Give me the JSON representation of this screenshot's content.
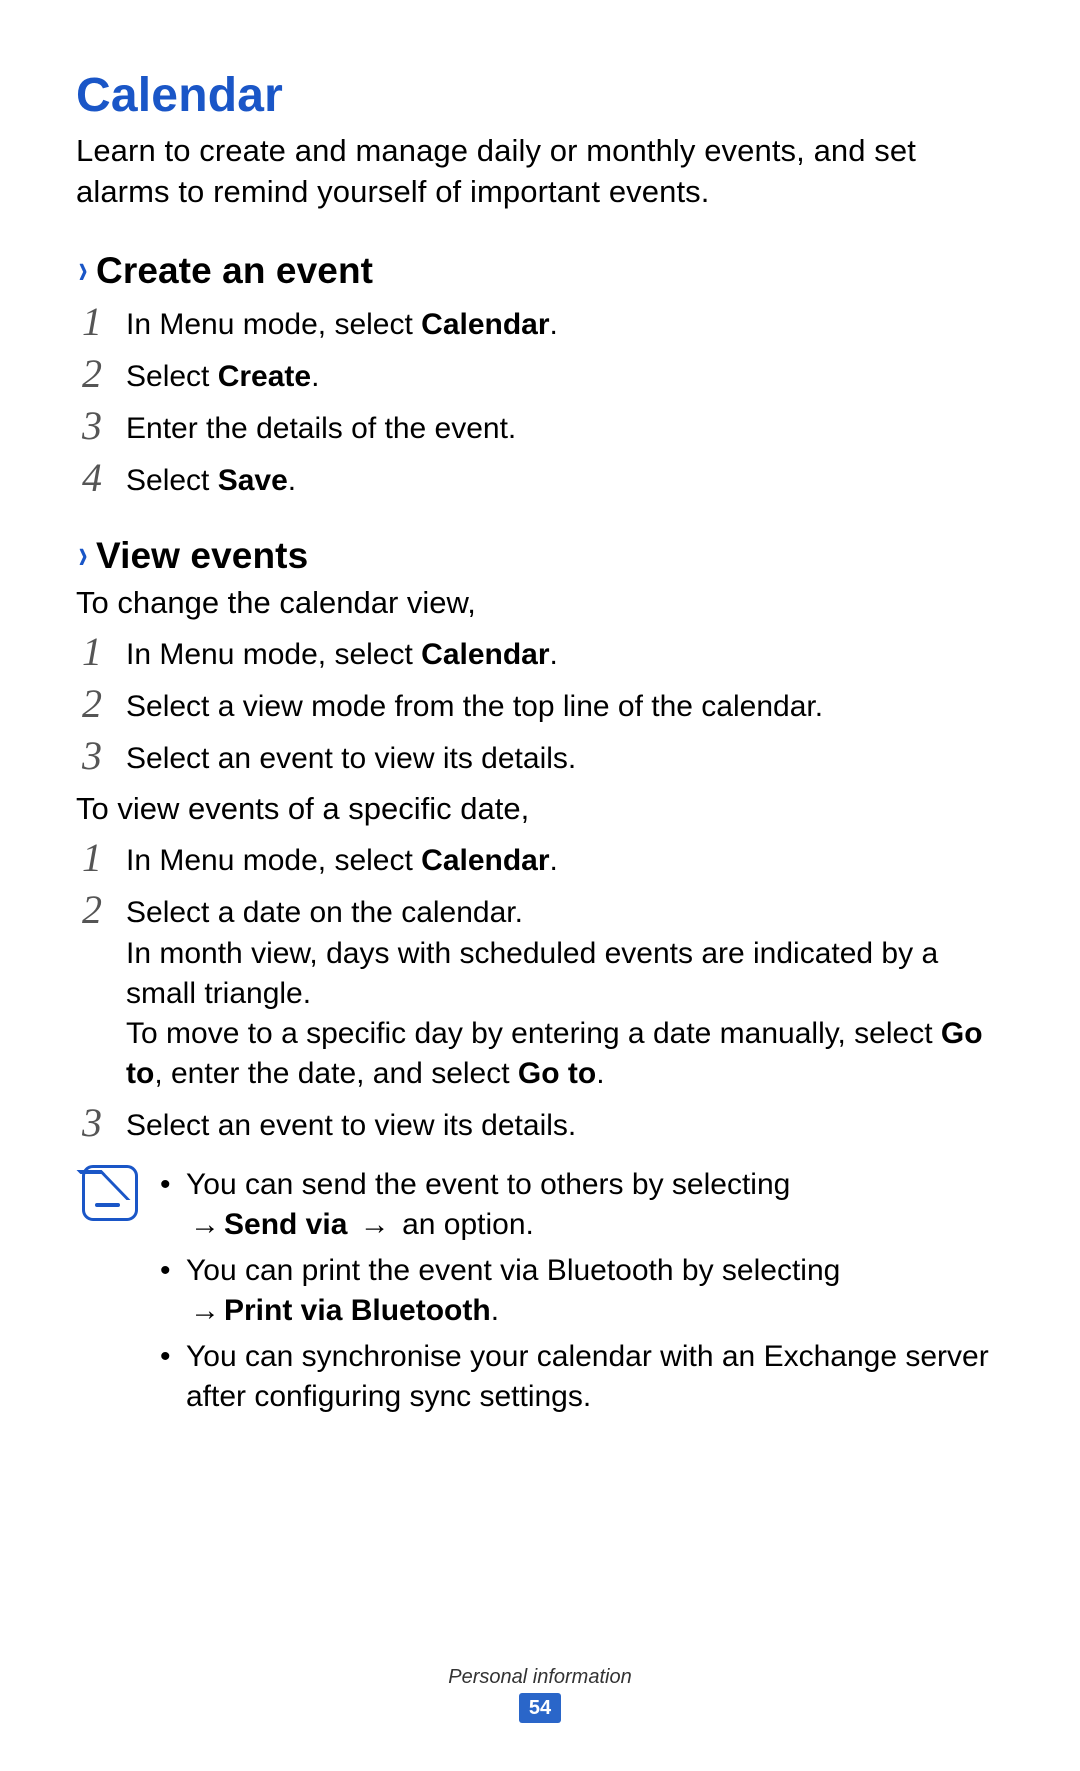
{
  "title": "Calendar",
  "intro": "Learn to create and manage daily or monthly events, and set alarms to remind yourself of important events.",
  "section1": {
    "chevron": "›",
    "title": "Create an event",
    "steps": [
      {
        "num": "1",
        "pre": "In Menu mode, select ",
        "bold": "Calendar",
        "post": "."
      },
      {
        "num": "2",
        "pre": "Select ",
        "bold": "Create",
        "post": "."
      },
      {
        "num": "3",
        "pre": "Enter the details of the event.",
        "bold": "",
        "post": ""
      },
      {
        "num": "4",
        "pre": "Select ",
        "bold": "Save",
        "post": "."
      }
    ]
  },
  "section2": {
    "chevron": "›",
    "title": "View events",
    "intro": "To change the calendar view,",
    "stepsA": [
      {
        "num": "1",
        "pre": "In Menu mode, select ",
        "bold": "Calendar",
        "post": "."
      },
      {
        "num": "2",
        "pre": "Select a view mode from the top line of the calendar.",
        "bold": "",
        "post": ""
      },
      {
        "num": "3",
        "pre": "Select an event to view its details.",
        "bold": "",
        "post": ""
      }
    ],
    "intro2": "To view events of a specific date,",
    "stepsB": {
      "s1": {
        "num": "1",
        "pre": "In Menu mode, select ",
        "bold": "Calendar",
        "post": "."
      },
      "s2": {
        "num": "2",
        "line1": "Select a date on the calendar.",
        "line2": "In month view, days with scheduled events are indicated by a small triangle.",
        "line3_pre": "To move to a specific day by entering a date manually, select ",
        "line3_b1": "Go to",
        "line3_mid": ", enter the date, and select ",
        "line3_b2": "Go to",
        "line3_post": "."
      },
      "s3": {
        "num": "3",
        "text": "Select an event to view its details."
      }
    }
  },
  "notes": {
    "bullet": "•",
    "arrow": "→",
    "items": {
      "n1": {
        "pre": "You can send the event to others by selecting ",
        "bold": "Send via",
        "post": " an option."
      },
      "n2": {
        "pre": "You can print the event via Bluetooth by selecting ",
        "bold": "Print via Bluetooth",
        "post": "."
      },
      "n3": {
        "text": "You can synchronise your calendar with an Exchange server after configuring sync settings."
      }
    }
  },
  "footer": {
    "section": "Personal information",
    "page": "54"
  }
}
